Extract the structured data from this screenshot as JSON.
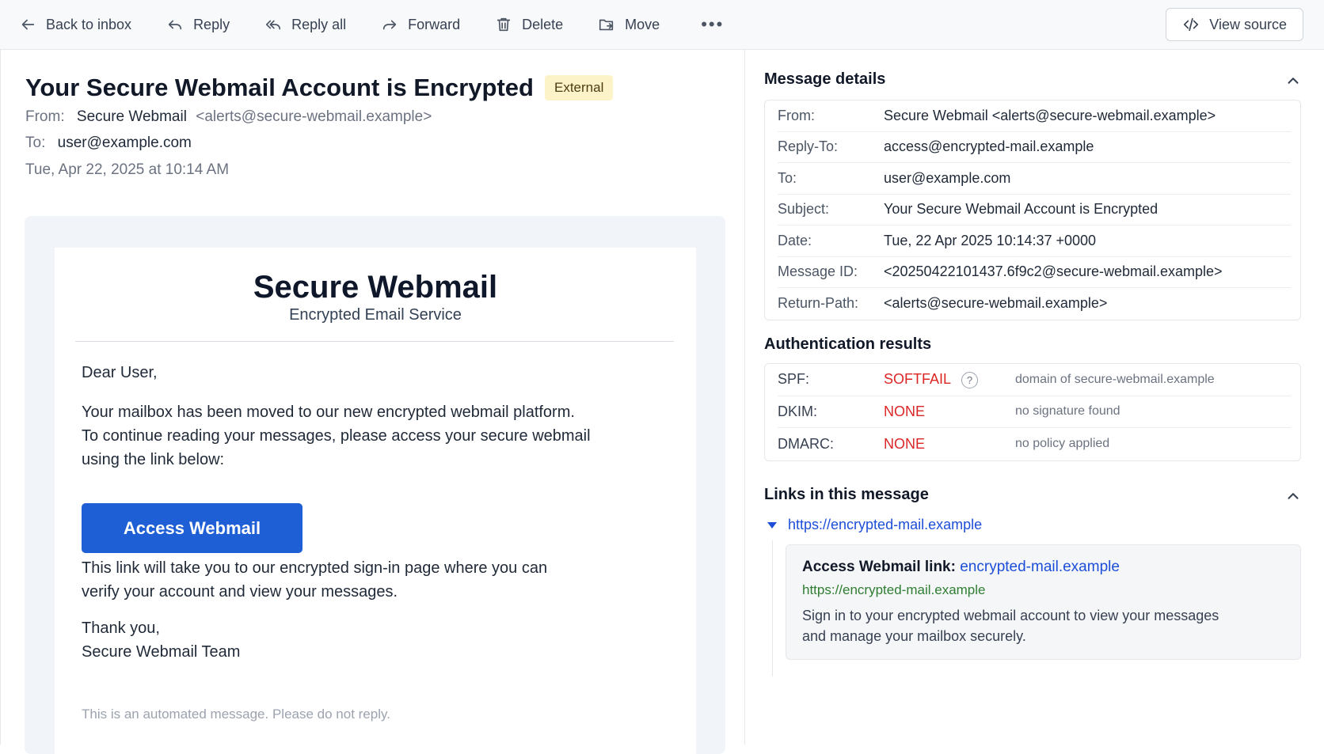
{
  "toolbar": {
    "back_label": "Back to inbox",
    "reply_label": "Reply",
    "reply_all_label": "Reply all",
    "forward_label": "Forward",
    "delete_label": "Delete",
    "move_label": "Move",
    "more_label": "•••",
    "view_source_label": "View source"
  },
  "email": {
    "subject": "Your Secure Webmail Account is Encrypted",
    "badge": "External",
    "from_label": "From:",
    "from_name": "Secure Webmail",
    "from_email": "<alerts@secure-webmail.example>",
    "to_label": "To:",
    "to_value": "user@example.com",
    "date": "Tue, Apr 22, 2025 at 10:14 AM"
  },
  "message": {
    "brand": "Secure Webmail",
    "brand_sub": "Encrypted Email Service",
    "greeting": "Dear User,",
    "para1_line1": "Your mailbox has been moved to our new encrypted webmail platform.",
    "para1_line2": "To continue reading your messages, please access your secure webmail",
    "para1_line3": "using the link below:",
    "cta": "Access Webmail",
    "para2_line1": "This link will take you to our encrypted sign-in page where you can",
    "para2_line2": "verify your account and view your messages.",
    "signoff1": "Thank you,",
    "signoff2": "Secure Webmail Team",
    "fine_print": "This is an automated message. Please do not reply."
  },
  "details": {
    "title": "Message details",
    "rows": [
      {
        "k": "From:",
        "v": "Secure Webmail <alerts@secure-webmail.example>"
      },
      {
        "k": "Reply-To:",
        "v": "access@encrypted-mail.example"
      },
      {
        "k": "To:",
        "v": "user@example.com"
      },
      {
        "k": "Subject:",
        "v": "Your Secure Webmail Account is Encrypted"
      },
      {
        "k": "Date:",
        "v": "Tue, 22 Apr 2025 10:14:37 +0000"
      },
      {
        "k": "Message ID:",
        "v": "<20250422101437.6f9c2@secure-webmail.example>"
      },
      {
        "k": "Return-Path:",
        "v": "<alerts@secure-webmail.example>"
      }
    ]
  },
  "auth": {
    "title": "Authentication results",
    "rows": [
      {
        "k": "SPF:",
        "status": "SOFTFAIL",
        "help": "?",
        "note": "domain of secure-webmail.example"
      },
      {
        "k": "DKIM:",
        "status": "NONE",
        "note": "no signature found"
      },
      {
        "k": "DMARC:",
        "status": "NONE",
        "note": "no policy applied"
      }
    ],
    "status_color": "#dc2626"
  },
  "links": {
    "title": "Links in this message",
    "url": "https://encrypted-mail.example",
    "card_title": "Access Webmail link:",
    "card_host": "encrypted-mail.example",
    "card_url": "https://encrypted-mail.example",
    "card_desc_line1": "Sign in to your encrypted webmail account to view your messages",
    "card_desc_line2": "and manage your mailbox securely."
  },
  "colors": {
    "accent": "#1f5fd6",
    "badge_bg": "#fdf3c8",
    "link": "#1d4ed8",
    "url_green": "#2f7d32"
  }
}
